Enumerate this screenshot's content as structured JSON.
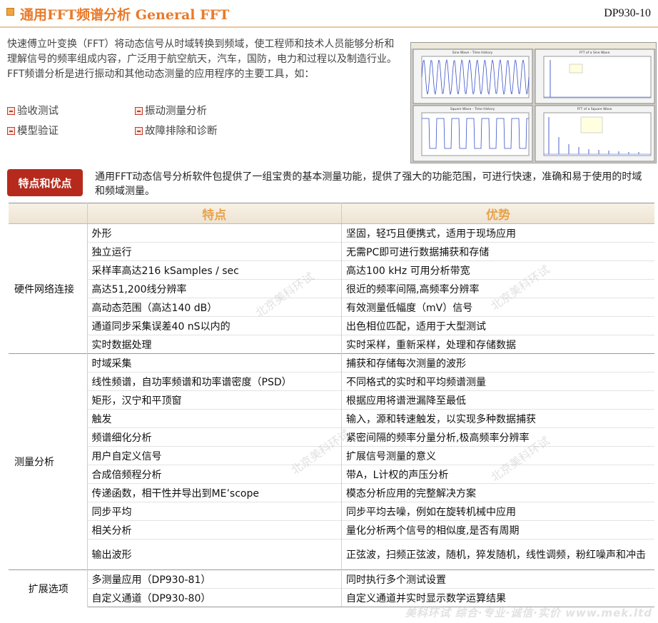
{
  "header": {
    "title": "通用FFT频谱分析 General FFT",
    "code": "DP930-10"
  },
  "intro": {
    "text": "快速傅立叶变换（FFT）将动态信号从时域转换到频域，使工程师和技术人员能够分析和理解信号的频率组成内容，广泛用于航空航天，汽车，国防，电力和过程以及制造行业。 FFT频谱分析是进行振动和其他动态测量的应用程序的主要工具，如：",
    "applications": [
      "验收测试",
      "振动测量分析",
      "模型验证",
      "故障排除和诊断"
    ]
  },
  "screenshot": {
    "panels": [
      "Sine Wave - Time History",
      "FFT of a Sine Wave",
      "Square Wave - Time History",
      "FFT of a Square Wave"
    ]
  },
  "banner": {
    "badge": "特点和优点",
    "text": "通用FFT动态信号分析软件包提供了一组宝贵的基本测量功能，提供了强大的功能范围，可进行快速，准确和易于使用的时域和频域测量。"
  },
  "table": {
    "headers": {
      "feature": "特点",
      "advantage": "优势"
    },
    "groups": [
      {
        "name": "硬件网络连接",
        "rows": [
          {
            "feature": "外形",
            "advantage": "坚固，轻巧且便携式，适用于现场应用"
          },
          {
            "feature": "独立运行",
            "advantage": "无需PC即可进行数据捕获和存储"
          },
          {
            "feature": "采样率高达216 kSamples / sec",
            "advantage": "高达100 kHz 可用分析带宽"
          },
          {
            "feature": "高达51,200线分辨率",
            "advantage": "很近的频率间隔,高频率分辨率"
          },
          {
            "feature": "高动态范围（高达140 dB）",
            "advantage": "有效测量低幅度（mV）信号"
          },
          {
            "feature": "通道同步采集误差40 nS以内的",
            "advantage": "出色相位匹配，适用于大型测试"
          },
          {
            "feature": "实时数据处理",
            "advantage": "实时采样，重新采样，处理和存储数据"
          }
        ]
      },
      {
        "name": "测量分析",
        "rows": [
          {
            "feature": "时域采集",
            "advantage": "捕获和存储每次测量的波形"
          },
          {
            "feature": "线性频谱，自功率频谱和功率谱密度（PSD）",
            "advantage": "不同格式的实时和平均频谱测量"
          },
          {
            "feature": "矩形，汉宁和平顶窗",
            "advantage": "根据应用将谱泄漏降至最低"
          },
          {
            "feature": "触发",
            "advantage": "输入，源和转速触发，以实现多种数据捕获"
          },
          {
            "feature": "频谱细化分析",
            "advantage": "紧密间隔的频率分量分析,极高频率分辨率"
          },
          {
            "feature": "用户自定义信号",
            "advantage": "扩展信号测量的意义"
          },
          {
            "feature": "合成倍频程分析",
            "advantage": "带A，L计权的声压分析"
          },
          {
            "feature": "传递函数，相干性并导出到ME’scope",
            "advantage": "模态分析应用的完整解决方案"
          },
          {
            "feature": "同步平均",
            "advantage": "同步平均去噪，例如在旋转机械中应用"
          },
          {
            "feature": "相关分析",
            "advantage": "量化分析两个信号的相似度,是否有周期"
          },
          {
            "feature": "输出波形",
            "advantage": "正弦波，扫频正弦波，随机，猝发随机，线性调频，粉红噪声和冲击"
          }
        ]
      },
      {
        "name": "扩展选项",
        "rows": [
          {
            "feature": "多测量应用（DP930-81）",
            "advantage": "同时执行多个测试设置"
          },
          {
            "feature": "自定义通道（DP930-80）",
            "advantage": "自定义通道并实时显示数学运算结果"
          }
        ]
      }
    ]
  },
  "watermark": "北京美科环试",
  "footer": "美科环试 综合·专业·诚信·实价 www.mek.ltd",
  "colors": {
    "title": "#e87a2a",
    "badge": "#b52a1c",
    "header_text": "#e8a24a"
  }
}
